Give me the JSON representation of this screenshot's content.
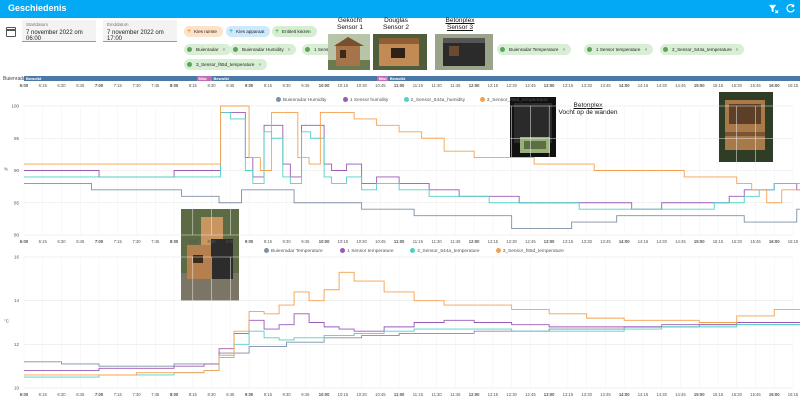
{
  "header": {
    "title": "Geschiedenis",
    "filter_icon": "filter-remove-icon",
    "refresh_icon": "refresh-icon"
  },
  "date_range": {
    "start_label": "Startdatum",
    "start_value": "7 november 2022 om 06:00",
    "end_label": "Einddatum",
    "end_value": "7 november 2022 om 17:00"
  },
  "actions": {
    "choose_area": "Kies ruimte",
    "choose_device": "Kies apparaat",
    "choose_entity": "Entiteit kiezen"
  },
  "entities": [
    "Buienradar",
    "Buienradar Humidity",
    "1 Sensor humidity",
    "Buienradar Temperature",
    "1 Sensor temperature",
    "2_Sensor_544a_temperature",
    "3_Sensor_f65d_temperature"
  ],
  "photo_captions": [
    {
      "line1": "Gekocht",
      "line2": "Sensor 1"
    },
    {
      "line1": "Douglas",
      "line2": "Sensor 2"
    },
    {
      "line1": "Betonplex",
      "line2": "Sensor 3"
    },
    {
      "line1": "Betonplex",
      "line2": "Vocht op de wanden"
    }
  ],
  "timeline": {
    "row_label": "Buienradar",
    "states": [
      "Bewolkt",
      "Bewolkt",
      "Mist",
      "Bewolkt",
      "Mist",
      "Bewolkt"
    ],
    "ticks": [
      "6:00",
      "6:15",
      "6:30",
      "6:45",
      "7:00",
      "7:15",
      "7:30",
      "7:45",
      "8:00",
      "8:15",
      "8:30",
      "8:45",
      "9:00",
      "9:15",
      "9:30",
      "9:45",
      "10:00",
      "10:15",
      "10:30",
      "10:45",
      "11:00",
      "11:15",
      "11:30",
      "11:45",
      "12:00",
      "12:15",
      "12:30",
      "12:45",
      "13:00",
      "13:15",
      "13:30",
      "13:45",
      "14:00",
      "14:15",
      "14:30",
      "14:45",
      "15:00",
      "15:15",
      "15:30",
      "15:45",
      "16:00",
      "16:15"
    ]
  },
  "colors": {
    "header": "#03a9f4",
    "timeline_bar": "#4a79a8",
    "mist": "#c26bb0"
  },
  "chart_data": [
    {
      "type": "line",
      "ylabel": "%",
      "ylim": [
        80,
        100
      ],
      "yticks": [
        80,
        85,
        90,
        95,
        100
      ],
      "x_ticks": [
        "6:00",
        "6:15",
        "6:30",
        "6:45",
        "7:00",
        "7:15",
        "7:30",
        "7:45",
        "8:00",
        "8:15",
        "8:30",
        "8:45",
        "9:00",
        "9:15",
        "9:30",
        "9:45",
        "10:00",
        "10:15",
        "10:30",
        "10:45",
        "11:00",
        "11:15",
        "11:30",
        "11:45",
        "12:00",
        "12:15",
        "12:30",
        "12:45",
        "13:00",
        "13:15",
        "13:30",
        "13:45",
        "14:00",
        "14:15",
        "14:30",
        "14:45",
        "15:00",
        "15:15",
        "15:30",
        "15:45",
        "16:00",
        "16:15"
      ],
      "series": [
        {
          "name": "Buienradar Humidity",
          "color": "#7f8fa6",
          "x": [
            0,
            0.3,
            0.9,
            1.5,
            2.1,
            2.4,
            2.6,
            2.8,
            2.9,
            3.3,
            3.6,
            3.9,
            4.1,
            4.5,
            4.9,
            5.2,
            5.6,
            6.0,
            6.5,
            6.9,
            7.3,
            7.6,
            7.9,
            8.3,
            8.7,
            9.2,
            9.6,
            10.0,
            10.3,
            10.6,
            10.85
          ],
          "y": [
            88,
            88,
            87,
            87,
            86,
            86,
            85,
            85,
            87,
            87,
            85,
            85,
            85,
            84,
            84,
            83,
            83,
            83,
            81,
            81,
            82,
            82,
            83,
            83,
            83,
            83,
            82,
            82,
            84,
            84,
            84
          ]
        },
        {
          "name": "1 Sensor humidity",
          "color": "#9b59b6",
          "x": [
            0,
            0.4,
            1.0,
            1.5,
            2.0,
            2.4,
            2.58,
            2.62,
            2.75,
            2.95,
            3.05,
            3.2,
            3.3,
            3.45,
            3.55,
            3.7,
            3.82,
            4.0,
            4.1,
            4.3,
            4.5,
            4.7,
            5.0,
            5.4,
            5.8,
            6.2,
            6.6,
            7.0,
            7.4,
            7.8,
            8.1,
            8.5,
            8.9,
            9.2,
            9.4,
            9.6,
            9.8,
            10.0,
            10.3,
            10.6,
            10.85
          ],
          "y": [
            90,
            90,
            89,
            89,
            90,
            90,
            90,
            99,
            99,
            92,
            89,
            97,
            97,
            91,
            89,
            97,
            97,
            91,
            90,
            91,
            88,
            89,
            88,
            87,
            86,
            86,
            85,
            85,
            85,
            85,
            84,
            85,
            85,
            85,
            86,
            87,
            87,
            88,
            87,
            88,
            87
          ]
        },
        {
          "name": "2_Sensor_544a_humidity",
          "color": "#4fd1c5",
          "x": [
            0,
            0.4,
            1.0,
            1.5,
            2.0,
            2.4,
            2.58,
            2.62,
            2.75,
            2.95,
            3.05,
            3.2,
            3.3,
            3.45,
            3.55,
            3.7,
            3.82,
            4.0,
            4.1,
            4.3,
            4.5,
            4.7,
            5.0,
            5.4,
            5.8,
            6.2,
            6.6,
            7.0,
            7.4,
            7.8,
            8.1,
            8.5,
            8.9,
            9.2,
            9.4,
            9.6,
            9.8,
            10.0,
            10.3,
            10.6,
            10.85
          ],
          "y": [
            89,
            89,
            89,
            89,
            89,
            89,
            89,
            99,
            98,
            90,
            88,
            96,
            95,
            89,
            88,
            96,
            95,
            89,
            88,
            89,
            87,
            88,
            87,
            86,
            86,
            85,
            85,
            85,
            84,
            84,
            84,
            84,
            84,
            85,
            85,
            86,
            87,
            88,
            88,
            88,
            88
          ]
        },
        {
          "name": "3_Sensor_f65d_temperature",
          "color": "#f6a04d",
          "x": [
            0,
            0.4,
            1.0,
            1.5,
            2.0,
            2.4,
            2.58,
            2.62,
            2.8,
            3.0,
            3.15,
            3.3,
            3.45,
            3.65,
            3.8,
            3.95,
            4.1,
            4.4,
            4.7,
            5.0,
            5.3,
            5.6,
            6.0,
            6.4,
            6.8,
            7.2,
            7.6,
            8.0,
            8.4,
            8.8,
            9.2,
            9.5,
            9.7,
            9.9,
            10.1,
            10.4,
            10.85
          ],
          "y": [
            91,
            91,
            91,
            91,
            91,
            91,
            91,
            100,
            100,
            92,
            90,
            99,
            99,
            92,
            91,
            99,
            99,
            98,
            97,
            96,
            95,
            93,
            92,
            92,
            91,
            91,
            90,
            90,
            90,
            89,
            89,
            88,
            87,
            85,
            87,
            89,
            89
          ]
        }
      ]
    },
    {
      "type": "line",
      "ylabel": "°C",
      "ylim": [
        10,
        16
      ],
      "yticks": [
        10,
        12,
        14,
        16
      ],
      "x_ticks": [
        "6:00",
        "6:15",
        "6:30",
        "6:45",
        "7:00",
        "7:15",
        "7:30",
        "7:45",
        "8:00",
        "8:15",
        "8:30",
        "8:45",
        "9:00",
        "9:15",
        "9:30",
        "9:45",
        "10:00",
        "10:15",
        "10:30",
        "10:45",
        "11:00",
        "11:15",
        "11:30",
        "11:45",
        "12:00",
        "12:15",
        "12:30",
        "12:45",
        "13:00",
        "13:15",
        "13:30",
        "13:45",
        "14:00",
        "14:15",
        "14:30",
        "14:45",
        "15:00",
        "15:15",
        "15:30",
        "15:45",
        "16:00",
        "16:15"
      ],
      "series": [
        {
          "name": "Buienradar Temperature",
          "color": "#7f8fa6",
          "x": [
            0,
            0.5,
            1.0,
            1.5,
            2.0,
            2.5,
            2.6,
            3.0,
            3.5,
            4.0,
            4.5,
            5.0,
            5.5,
            6.0,
            6.5,
            7.0,
            7.5,
            8.0,
            8.5,
            9.0,
            9.5,
            10.0,
            10.5,
            10.85
          ],
          "y": [
            11.2,
            11.1,
            11.0,
            11.0,
            11.1,
            11.1,
            11.6,
            11.9,
            12.1,
            12.3,
            12.4,
            12.5,
            12.5,
            12.6,
            12.6,
            12.7,
            12.7,
            12.8,
            12.8,
            12.9,
            12.9,
            12.9,
            12.8,
            12.8
          ]
        },
        {
          "name": "1 Sensor temperature",
          "color": "#9b59b6",
          "x": [
            0,
            0.5,
            1.0,
            1.5,
            2.0,
            2.4,
            2.6,
            2.8,
            3.0,
            3.2,
            3.4,
            3.6,
            3.8,
            4.0,
            4.2,
            4.4,
            4.8,
            5.2,
            5.6,
            6.0,
            6.5,
            7.0,
            7.5,
            8.0,
            8.5,
            9.0,
            9.5,
            10.0,
            10.5,
            10.85
          ],
          "y": [
            10.8,
            10.8,
            10.9,
            10.9,
            11.0,
            11.1,
            11.8,
            12.5,
            13.1,
            12.7,
            12.9,
            13.4,
            13.0,
            12.8,
            12.7,
            12.6,
            12.8,
            13.0,
            13.1,
            13.0,
            12.9,
            12.8,
            12.8,
            12.8,
            12.9,
            12.9,
            13.0,
            13.0,
            13.1,
            13.1
          ]
        },
        {
          "name": "2_Sensor_544a_temperature",
          "color": "#4fd1c5",
          "x": [
            0,
            0.5,
            1.0,
            1.5,
            2.0,
            2.4,
            2.6,
            2.8,
            3.0,
            3.2,
            3.4,
            3.6,
            3.8,
            4.0,
            4.2,
            4.4,
            4.8,
            5.2,
            5.6,
            6.0,
            6.5,
            7.0,
            7.5,
            8.0,
            8.5,
            9.0,
            9.5,
            10.0,
            10.5,
            10.85
          ],
          "y": [
            10.5,
            10.5,
            10.6,
            10.6,
            10.7,
            10.8,
            11.4,
            12.0,
            12.6,
            12.3,
            12.2,
            12.3,
            12.3,
            12.4,
            12.4,
            12.5,
            12.6,
            12.7,
            12.7,
            12.7,
            12.6,
            12.6,
            12.6,
            12.7,
            12.8,
            12.8,
            12.9,
            12.9,
            13.0,
            13.0
          ]
        },
        {
          "name": "3_Sensor_f65d_temperature",
          "color": "#f6a04d",
          "x": [
            0,
            0.5,
            1.0,
            1.5,
            2.0,
            2.4,
            2.6,
            2.8,
            3.0,
            3.2,
            3.4,
            3.6,
            3.8,
            4.0,
            4.2,
            4.4,
            4.8,
            5.2,
            5.6,
            6.0,
            6.5,
            7.0,
            7.5,
            8.0,
            8.5,
            9.0,
            9.5,
            10.0,
            10.5,
            10.85
          ],
          "y": [
            10.6,
            10.6,
            10.6,
            10.7,
            10.7,
            10.8,
            11.5,
            12.6,
            13.5,
            13.4,
            13.8,
            14.4,
            14.0,
            14.5,
            15.3,
            14.9,
            14.4,
            14.0,
            13.8,
            13.8,
            13.6,
            13.4,
            13.2,
            13.1,
            13.1,
            13.0,
            13.3,
            13.6,
            13.7,
            13.7
          ]
        }
      ]
    }
  ]
}
